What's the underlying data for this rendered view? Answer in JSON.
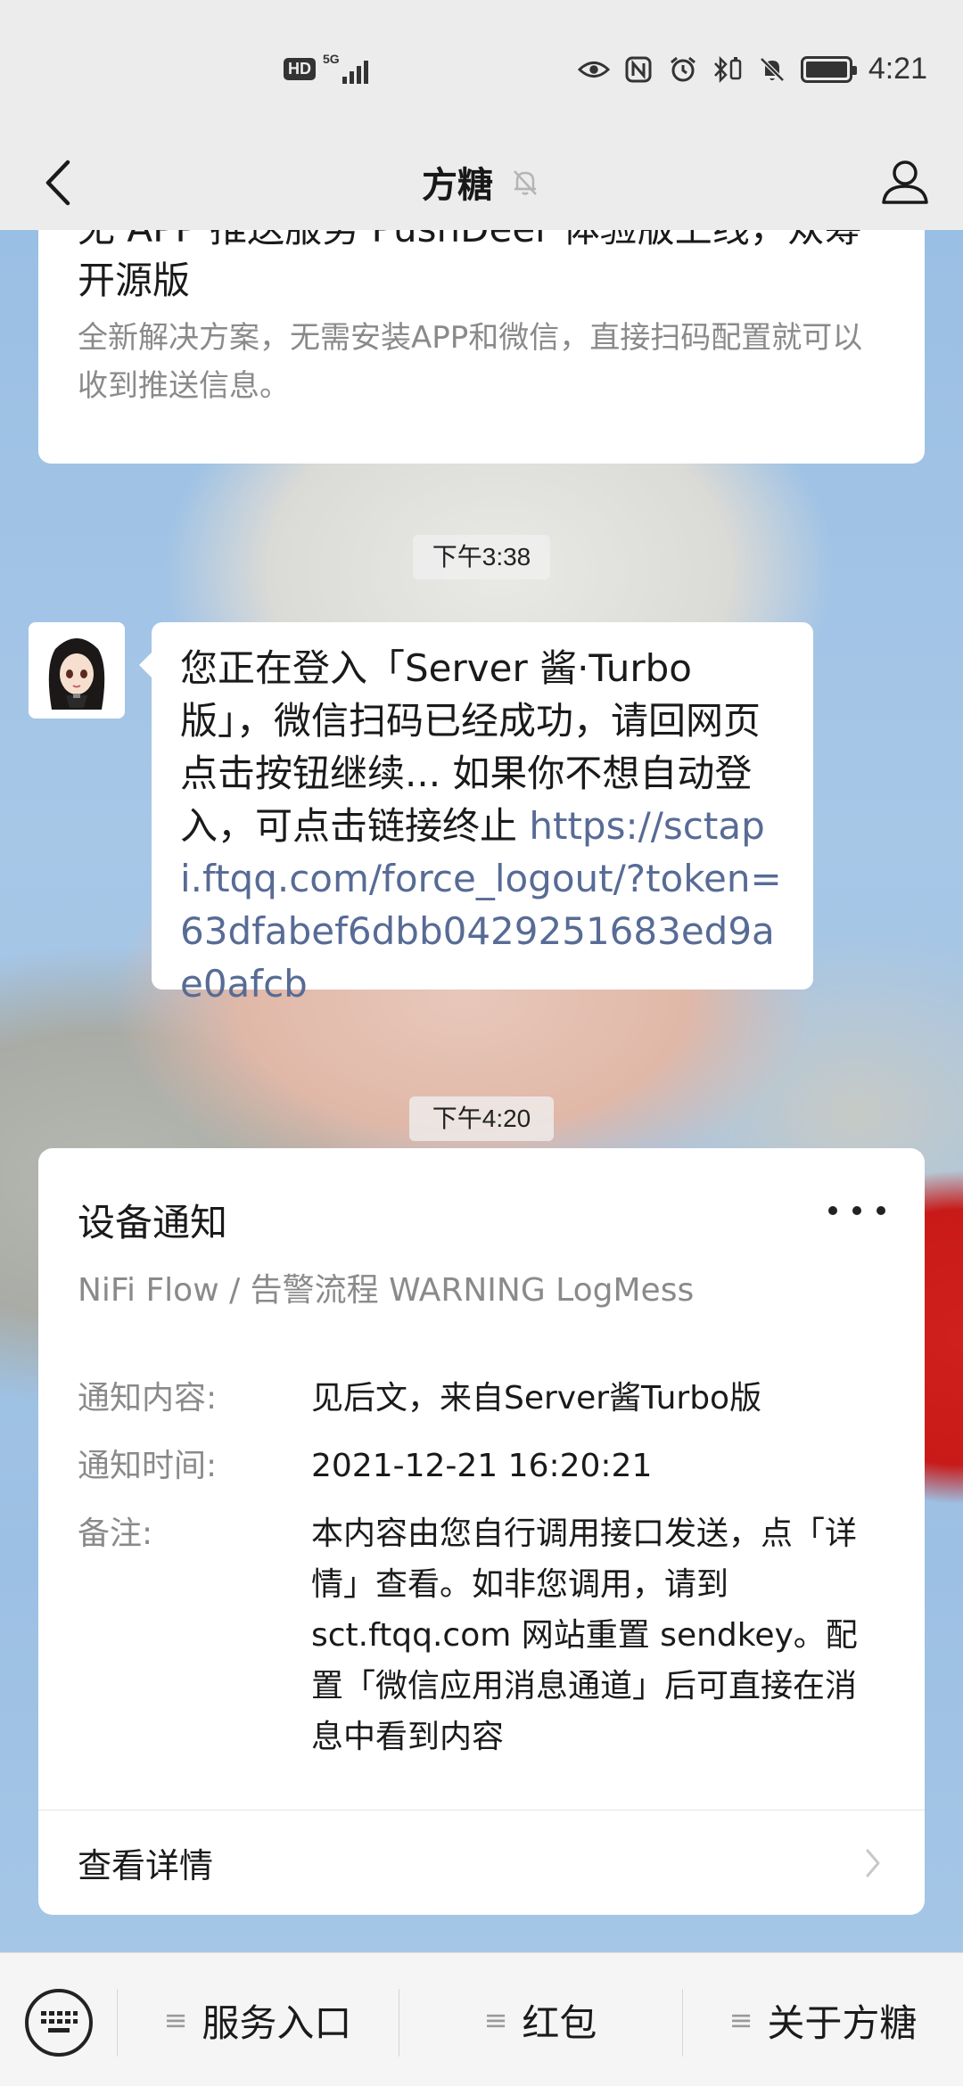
{
  "status_bar": {
    "hd": "HD",
    "network": "5G",
    "time": "4:21"
  },
  "nav": {
    "title": "方糖",
    "back_icon": "chevron-left-icon",
    "mute_icon": "bell-muted-icon",
    "profile_icon": "person-icon"
  },
  "top_card": {
    "title": "无 APP 推送服务 PushDeer 体验版上线，众筹开源版",
    "description": "全新解决方案，无需安装APP和微信，直接扫码配置就可以收到推送信息。"
  },
  "messages": {
    "time1": "下午3:38",
    "bubble_text": "您正在登入「Server 酱·Turbo 版」，微信扫码已经成功，请回网页点击按钮继续... 如果你不想自动登入，可点击链接终止 ",
    "bubble_link": "https://sctapi.ftqq.com/force_logout/?token=63dfabef6dbb0429251683ed9ae0afcb",
    "time2": "下午4:20"
  },
  "notify_card": {
    "title": "设备通知",
    "subtitle": "NiFi Flow / 告警流程 WARNING LogMess",
    "fields": [
      {
        "label": "通知内容:",
        "value": "见后文，来自Server酱Turbo版"
      },
      {
        "label": "通知时间:",
        "value": "2021-12-21 16:20:21"
      },
      {
        "label": "备注:",
        "value": "本内容由您自行调用接口发送，点「详情」查看。如非您调用，请到 sct.ftqq.com 网站重置 sendkey。配置「微信应用消息通道」后可直接在消息中看到内容"
      }
    ],
    "detail_label": "查看详情"
  },
  "bottom_menu": {
    "items": [
      {
        "label": "服务入口"
      },
      {
        "label": "红包"
      },
      {
        "label": "关于方糖"
      }
    ]
  },
  "colors": {
    "link": "#576b95",
    "bar_bg": "#ececec",
    "secondary_text": "#8a8a8a"
  }
}
